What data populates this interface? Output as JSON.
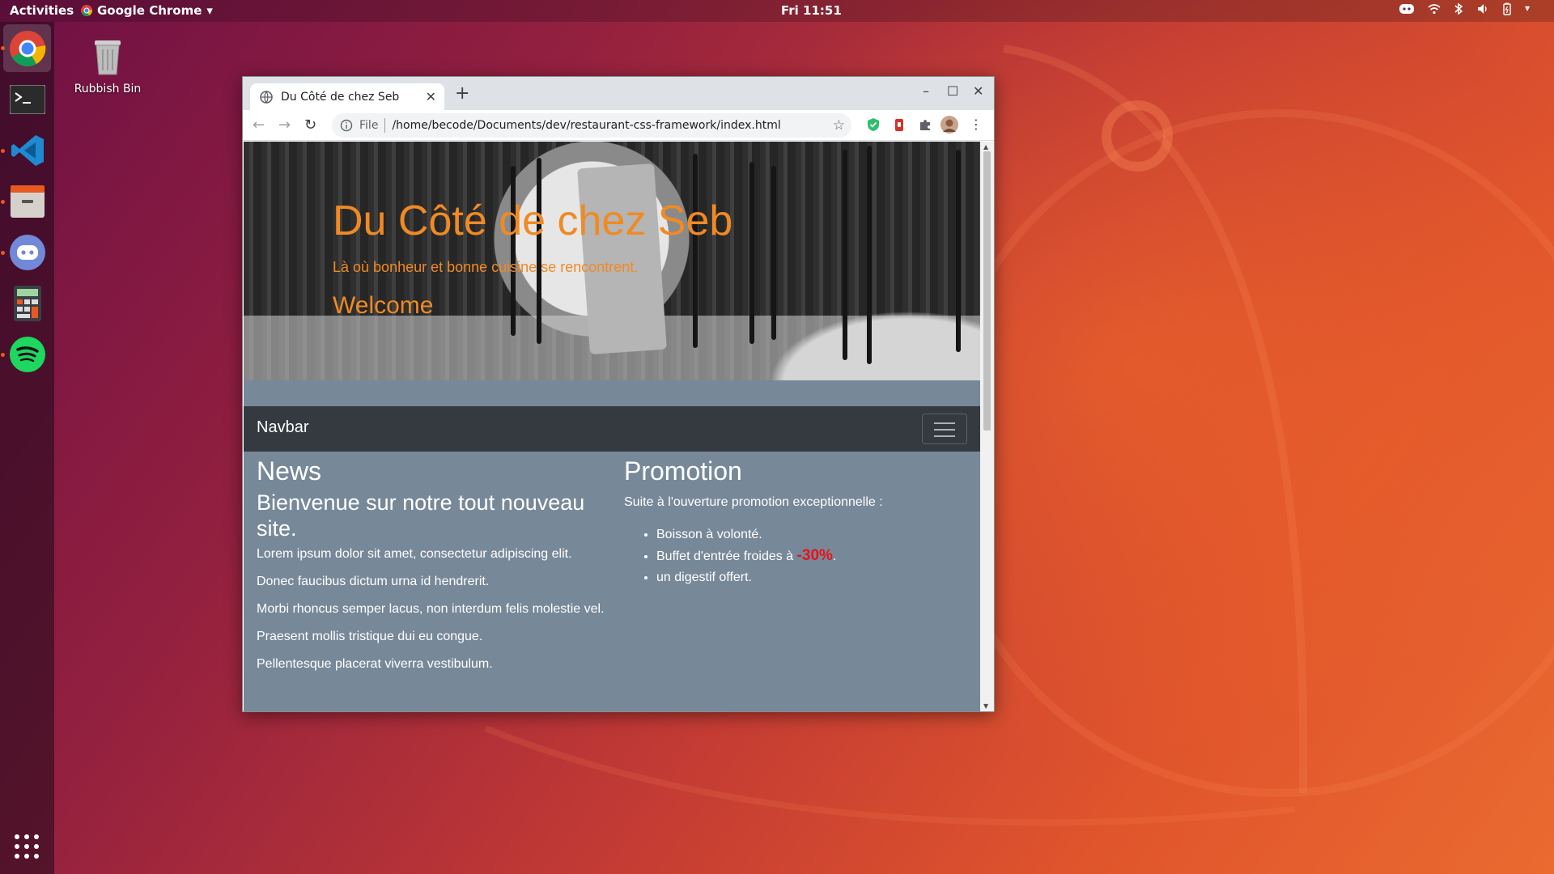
{
  "topbar": {
    "activities": "Activities",
    "app_name": "Google Chrome",
    "clock": "Fri 11:51"
  },
  "dock": {
    "items": [
      "chrome-icon",
      "terminal-icon",
      "vscode-icon",
      "file-manager-icon",
      "discord-icon",
      "calculator-icon",
      "spotify-icon"
    ]
  },
  "desktop": {
    "trash_label": "Rubbish Bin"
  },
  "browser": {
    "tab_title": "Du Côté de chez Seb",
    "url_scheme_label": "File",
    "url": "/home/becode/Documents/dev/restaurant-css-framework/index.html"
  },
  "page": {
    "hero": {
      "title": "Du Côté de chez Seb",
      "subtitle": "Là où bonheur et bonne cuisine se rencontrent.",
      "welcome": "Welcome"
    },
    "navbar": {
      "brand": "Navbar"
    },
    "news": {
      "heading": "News",
      "subheading": "Bienvenue sur notre tout nouveau site.",
      "paragraphs": [
        "Lorem ipsum dolor sit amet, consectetur adipiscing elit.",
        "Donec faucibus dictum urna id hendrerit.",
        "Morbi rhoncus semper lacus, non interdum felis molestie vel.",
        "Praesent mollis tristique dui eu congue.",
        "Pellentesque placerat viverra vestibulum."
      ]
    },
    "promotion": {
      "heading": "Promotion",
      "intro": "Suite à l'ouverture promotion exceptionnelle :",
      "item1": "Boisson à volonté.",
      "item2_prefix": "Buffet d'entrée froides à ",
      "item2_discount": "-30%",
      "item2_suffix": ".",
      "item3": "un digestif offert."
    }
  },
  "colors": {
    "hero_text": "#f08a24",
    "page_background": "#778899",
    "navbar_background": "#343a40",
    "discount": "#e8121a"
  }
}
